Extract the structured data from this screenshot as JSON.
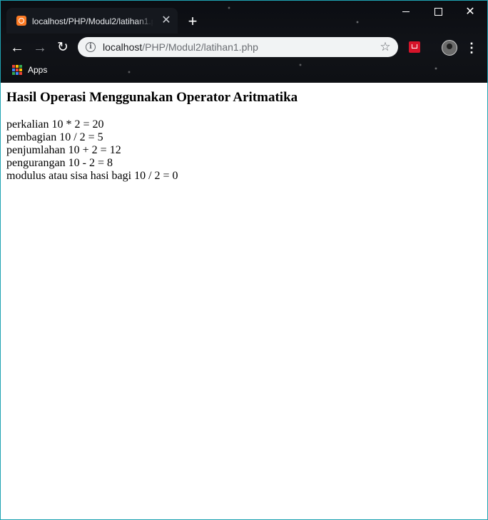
{
  "tab": {
    "title": "localhost/PHP/Modul2/latihan1.php",
    "close": "✕",
    "favicon": "xampp-icon"
  },
  "new_tab": "+",
  "window_controls": {
    "close": "✕"
  },
  "toolbar": {
    "back": "←",
    "forward": "→",
    "reload": "↻",
    "address": {
      "host": "localhost",
      "path": "/PHP/Modul2/latihan1.php"
    },
    "info": "i",
    "star": "☆",
    "menu": "⋮"
  },
  "bookmarks": {
    "apps_label": "Apps",
    "apps_colors": [
      "#ea4335",
      "#fbbc05",
      "#34a853",
      "#4285f4",
      "#ea4335",
      "#fbbc05",
      "#34a853",
      "#4285f4",
      "#ea4335"
    ]
  },
  "page": {
    "heading": "Hasil Operasi Menggunakan Operator Aritmatika",
    "lines": [
      "perkalian 10 * 2 = 20",
      "pembagian 10 / 2 = 5",
      "penjumlahan 10 + 2 = 12",
      "pengurangan 10 - 2 = 8",
      "modulus atau sisa hasi bagi 10 / 2 = 0"
    ]
  }
}
